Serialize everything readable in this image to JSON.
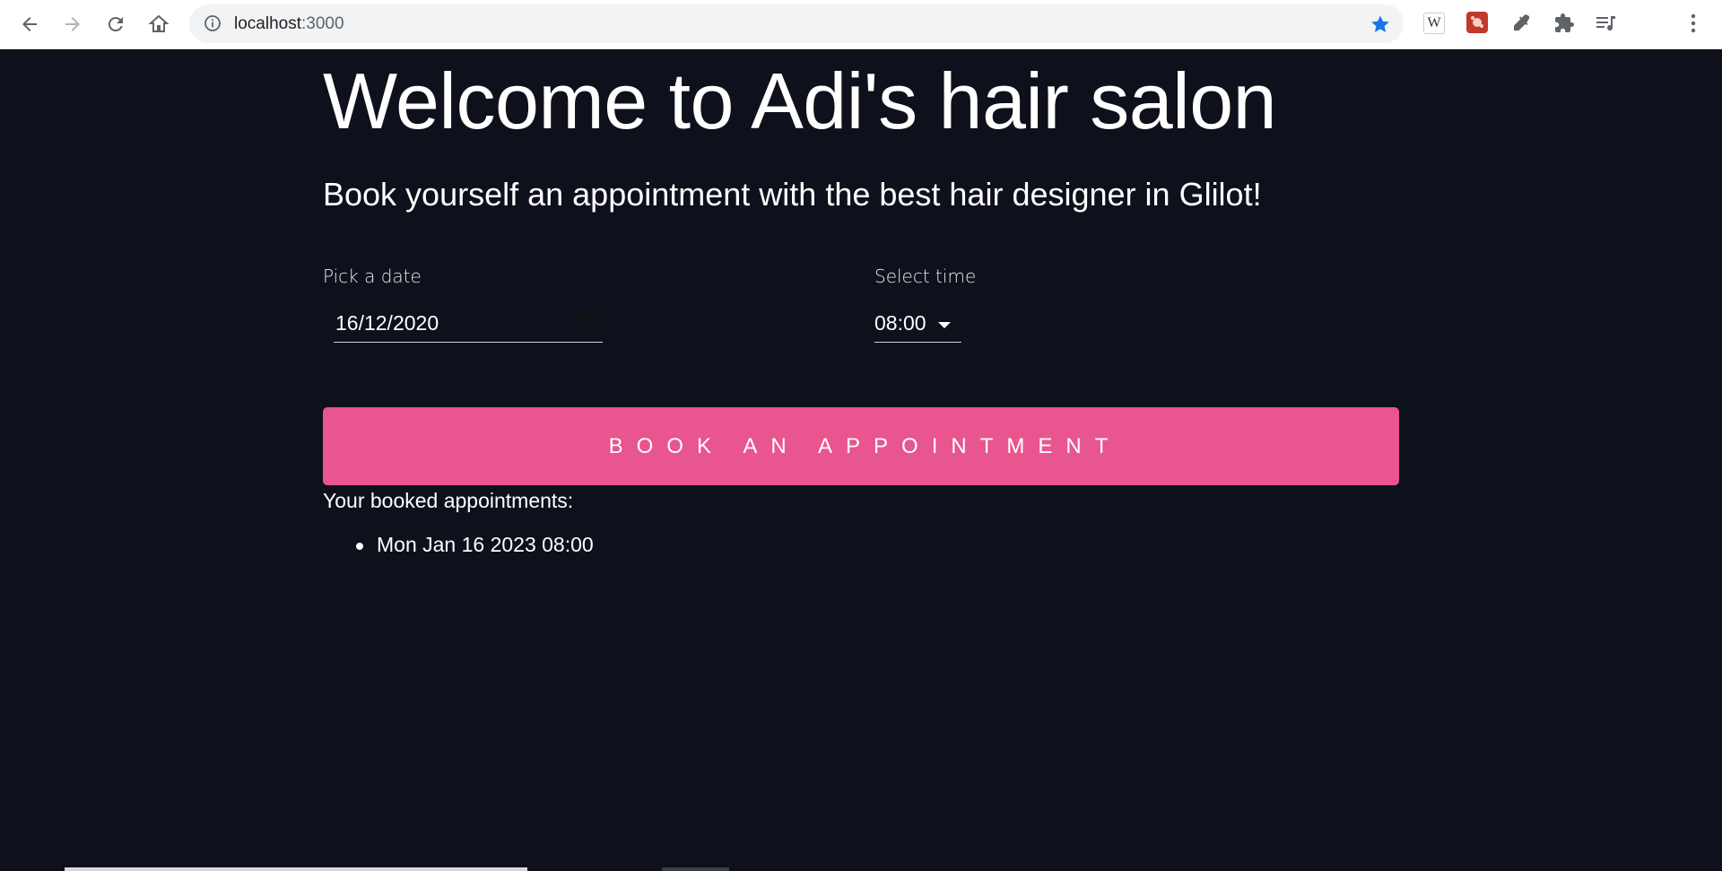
{
  "browser": {
    "url_host": "localhost",
    "url_port": ":3000",
    "extensions": [
      "wikipedia-extension-icon",
      "red-extension-icon",
      "eyedropper-icon",
      "puzzle-icon",
      "media-queue-icon"
    ],
    "ext_w_label": "W"
  },
  "page": {
    "title": "Welcome to Adi's hair salon",
    "subtitle": "Book yourself an appointment with the best hair designer in Glilot!",
    "date_label": "Pick a date",
    "date_value": "16/12/2020",
    "time_label": "Select time",
    "time_value": "08:00",
    "book_button": "Book an appointment",
    "booked_title": "Your booked appointments:",
    "appointments": [
      "Mon Jan 16 2023 08:00"
    ]
  },
  "colors": {
    "background": "#0e101b",
    "accent": "#e9558e",
    "text": "#ffffff"
  }
}
